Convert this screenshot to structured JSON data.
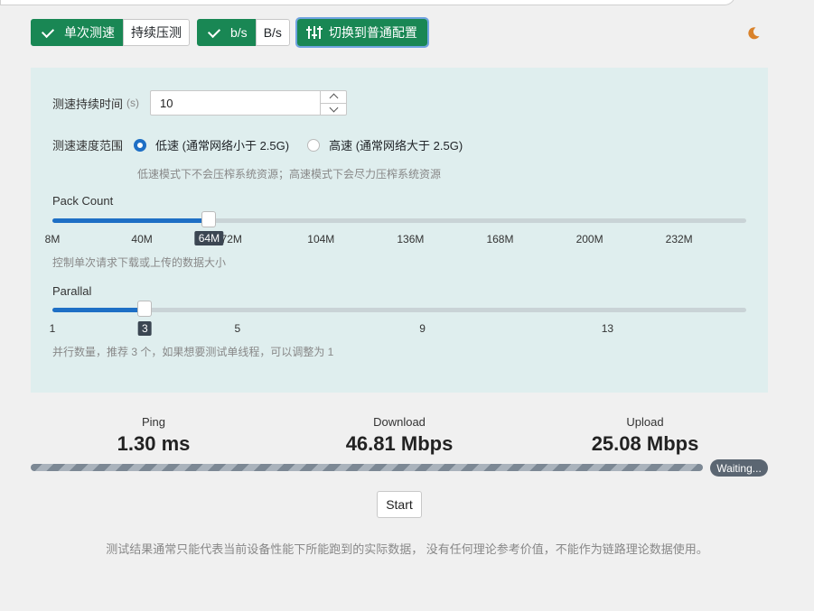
{
  "toolbar": {
    "mode_single": "单次测速",
    "mode_continuous": "持续压测",
    "unit_bits": "b/s",
    "unit_bytes": "B/s",
    "switch_config": "切换到普通配置"
  },
  "config": {
    "duration_label": "测速持续时间",
    "duration_unit": "(s)",
    "duration_value": "10",
    "range_label": "测速速度范围",
    "range_low": "低速 (通常网络小于 2.5G)",
    "range_high": "高速 (通常网络大于 2.5G)",
    "range_hint": "低速模式下不会压榨系统资源；高速模式下会尽力压榨系统资源",
    "pack_count": {
      "title": "Pack Count",
      "ticks": [
        "8M",
        "40M",
        "72M",
        "104M",
        "136M",
        "168M",
        "200M",
        "232M"
      ],
      "min": 8,
      "max": 256,
      "value": 64,
      "value_label": "64M",
      "hint": "控制单次请求下载或上传的数据大小"
    },
    "parallel": {
      "title": "Parallal",
      "ticks": [
        "1",
        "5",
        "9",
        "13"
      ],
      "min": 1,
      "max": 16,
      "value": 3,
      "value_label": "3",
      "hint": "并行数量，推荐 3 个，如果想要测试单线程，可以调整为 1"
    }
  },
  "stats": {
    "ping_label": "Ping",
    "ping_value": "1.30 ms",
    "download_label": "Download",
    "download_value": "46.81 Mbps",
    "upload_label": "Upload",
    "upload_value": "25.08 Mbps"
  },
  "status": "Waiting...",
  "start_label": "Start",
  "footer": "测试结果通常只能代表当前设备性能下所能跑到的实际数据， 没有任何理论参考价值，不能作为链路理论数据使用。",
  "colors": {
    "primary": "#198754",
    "accent": "#1e6fc5",
    "moon": "#d9822b"
  }
}
